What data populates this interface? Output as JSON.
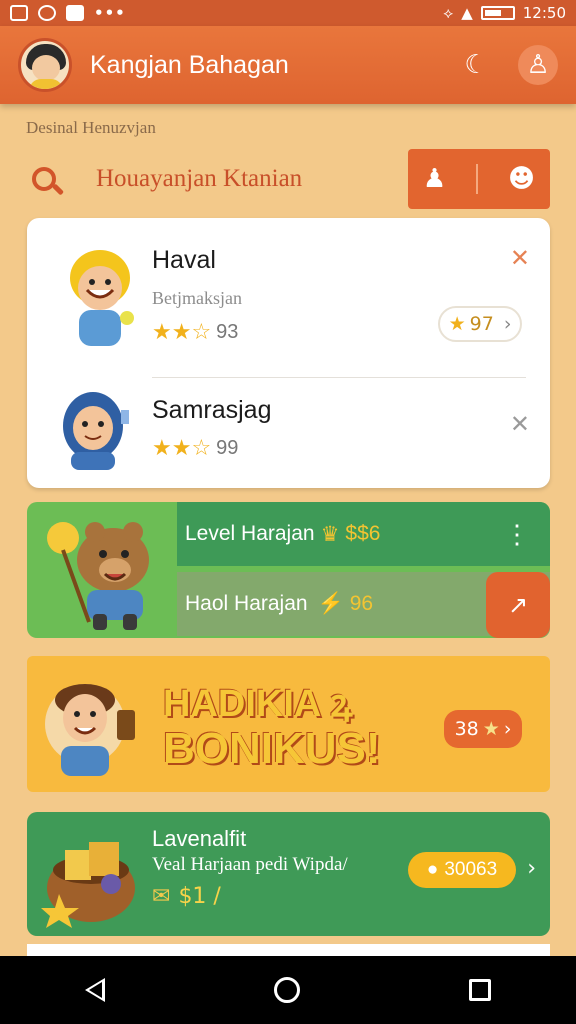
{
  "status_bar": {
    "time": "12:50",
    "dots": "•••"
  },
  "app_bar": {
    "title": "Kangjan Bahagan"
  },
  "section_caption": "Desinal Henuzvjan",
  "search": {
    "text": "Houayanjan Ktanian"
  },
  "list": {
    "items": [
      {
        "name": "Haval",
        "subtitle": "Betjmaksjan",
        "stars": "★★☆",
        "rating": "93",
        "badge_value": "97"
      },
      {
        "name": "Samrasjag",
        "stars": "★★☆",
        "rating": "99"
      }
    ]
  },
  "level_card": {
    "top_label": "Level Harajan",
    "top_value": "$$6",
    "bottom_label": "Haol Harajan",
    "bottom_value": "96"
  },
  "bonus": {
    "title": "HADIKIA ꝝ",
    "subtitle": "BONIKUS!",
    "badge_value": "38"
  },
  "reward": {
    "title": "Lavenalfit",
    "description": "Veal Harjaan pedi Wipda/",
    "price": "$1 /",
    "pill_value": "30063"
  },
  "colors": {
    "primary": "#e2652f",
    "green": "#3e9a57",
    "banner": "#f8ba3e",
    "star": "#f1b11c"
  }
}
